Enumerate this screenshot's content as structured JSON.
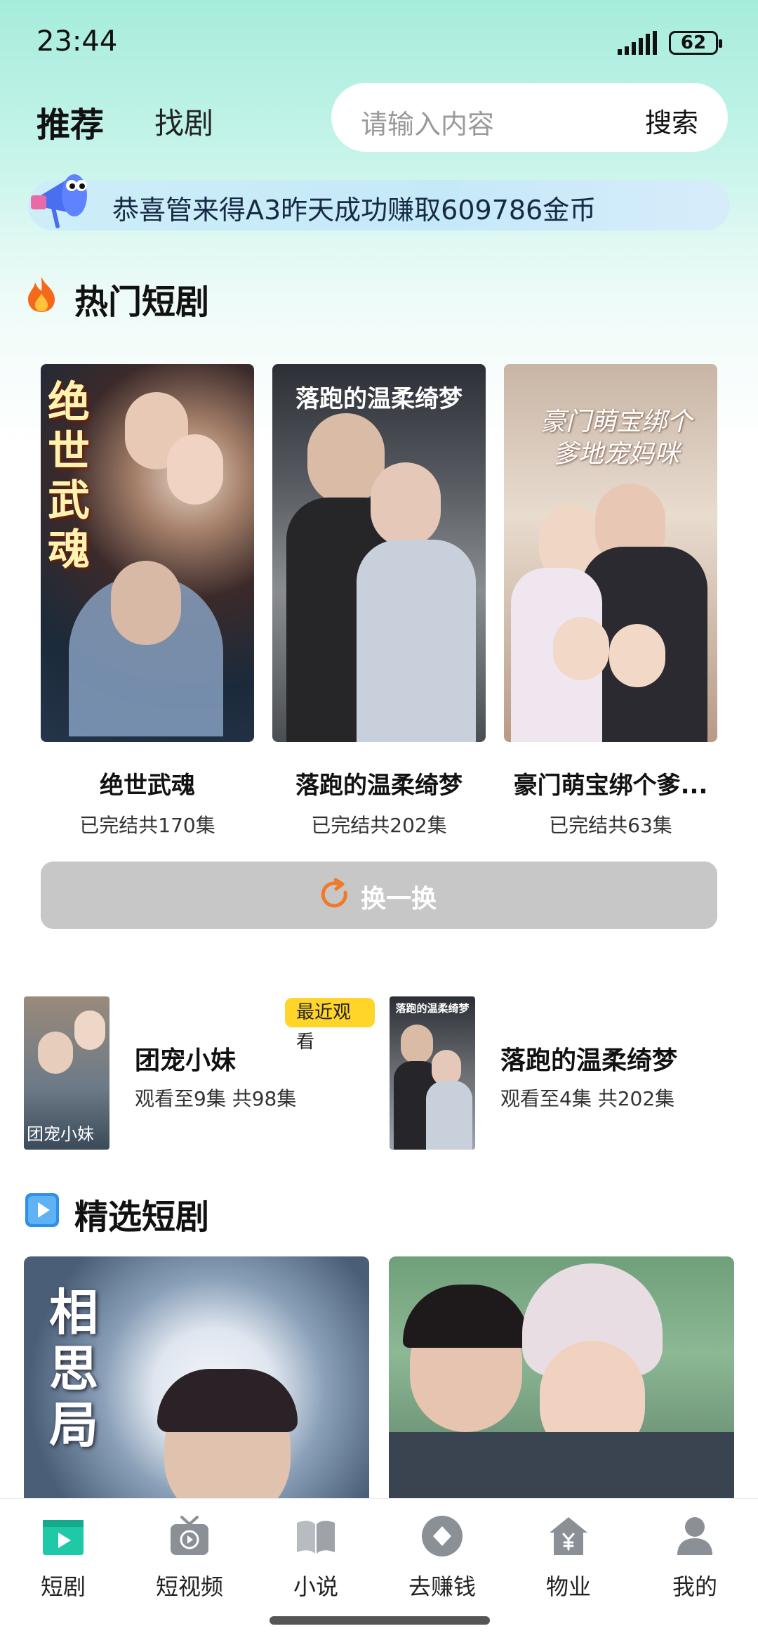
{
  "status_bar": {
    "time": "23:44",
    "battery": "62"
  },
  "header": {
    "tabs": [
      {
        "label": "推荐"
      },
      {
        "label": "找剧"
      }
    ],
    "search": {
      "placeholder": "请输入内容",
      "button_label": "搜索"
    }
  },
  "notice": {
    "text": "恭喜管来得A3昨天成功赚取609786金币"
  },
  "hot_section": {
    "title": "热门短剧",
    "items": [
      {
        "name": "绝世武魂",
        "status": "已完结共170集",
        "poster_text": "绝世武魂"
      },
      {
        "name": "落跑的温柔绮梦",
        "status": "已完结共202集",
        "poster_text": "落跑的温柔绮梦"
      },
      {
        "name": "豪门萌宝绑个爹...",
        "status": "已完结共63集",
        "poster_text": "豪门萌宝绑个爹地宠妈咪"
      }
    ],
    "refresh_label": "换一换"
  },
  "recent": {
    "badge": "最近观看",
    "items": [
      {
        "title": "团宠小妹",
        "progress": "观看至9集 共98集",
        "poster_text": "团宠小妹"
      },
      {
        "title": "落跑的温柔绮梦",
        "progress": "观看至4集 共202集",
        "poster_text": "落跑的温柔绮梦"
      }
    ]
  },
  "featured_section": {
    "title": "精选短剧",
    "items": [
      {
        "poster_text": "相思局"
      },
      {
        "poster_text": ""
      }
    ]
  },
  "bottom_nav": [
    {
      "label": "短剧",
      "icon": "clapperboard-icon",
      "active": true
    },
    {
      "label": "短视频",
      "icon": "tv-play-icon"
    },
    {
      "label": "小说",
      "icon": "book-icon"
    },
    {
      "label": "去赚钱",
      "icon": "diamond-coin-icon"
    },
    {
      "label": "物业",
      "icon": "house-yen-icon"
    },
    {
      "label": "我的",
      "icon": "person-icon"
    }
  ],
  "colors": {
    "accent": "#1fc9a8",
    "badge": "#ffd52a",
    "refresh_icon": "#f07a2a"
  }
}
